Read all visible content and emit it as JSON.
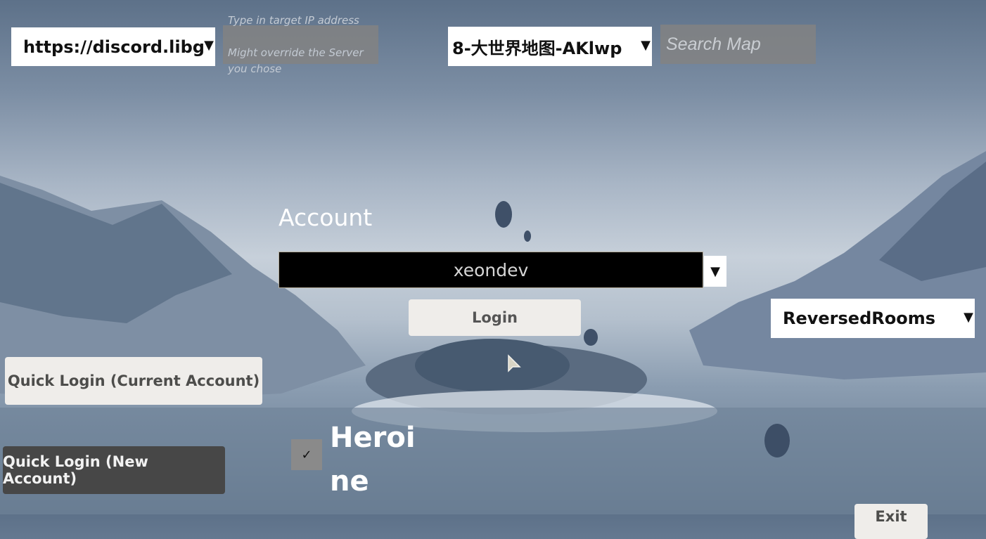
{
  "server": {
    "selected": "https://discord.libg.so",
    "arrow_icon": "▼"
  },
  "ip_override": {
    "hint_line1": "Type in target IP address",
    "hint_line2": "Might override the Server",
    "hint_line3": "you chose",
    "value": ""
  },
  "map": {
    "selected": "8-大世界地图-AKlwp",
    "arrow_icon": "▼",
    "search_placeholder": "Search Map"
  },
  "account": {
    "label": "Account",
    "selected": "xeondev",
    "arrow_icon": "▼",
    "login_label": "Login"
  },
  "mode": {
    "selected": "ReversedRooms",
    "arrow_icon": "▼"
  },
  "quick_login": {
    "current_label": "Quick Login (Current Account)",
    "new_label": "Quick Login (New Account)"
  },
  "heroine": {
    "checked": true,
    "check_icon": "✓",
    "label_line1": "Heroi",
    "label_line2": "ne"
  },
  "exit": {
    "label": "Exit"
  },
  "colors": {
    "account_field_bg": "#000000",
    "dark_button_bg": "#474747",
    "light_button_bg": "#efedea"
  }
}
